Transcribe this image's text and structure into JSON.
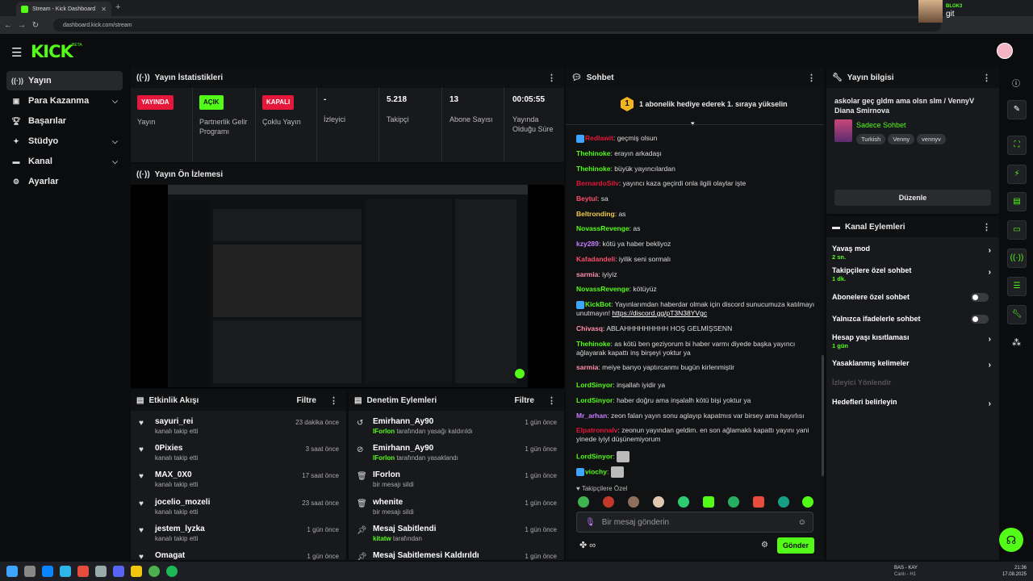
{
  "browser": {
    "tab_title": "Stream - Kick Dashboard",
    "url": "dashboard.kick.com/stream",
    "webcam_channel": "BLOK3",
    "webcam_user": "git"
  },
  "app": {
    "logo": "KICK",
    "logo_badge": "BETA"
  },
  "sidebar": {
    "items": [
      {
        "label": "Yayın"
      },
      {
        "label": "Para Kazanma"
      },
      {
        "label": "Başarılar"
      },
      {
        "label": "Stüdyo"
      },
      {
        "label": "Kanal"
      },
      {
        "label": "Ayarlar"
      }
    ]
  },
  "stats": {
    "title": "Yayın İstatistikleri",
    "items": [
      {
        "value": "YAYINDA",
        "label": "Yayın"
      },
      {
        "value": "AÇIK",
        "label": "Partnerlik Gelir Programı"
      },
      {
        "value": "KAPALI",
        "label": "Çoklu Yayın"
      },
      {
        "value": "-",
        "label": "İzleyici"
      },
      {
        "value": "5.218",
        "label": "Takipçi"
      },
      {
        "value": "13",
        "label": "Abone Sayısı"
      },
      {
        "value": "00:05:55",
        "label": "Yayında Olduğu Süre"
      }
    ]
  },
  "preview": {
    "title": "Yayın Ön İzlemesi"
  },
  "activity": {
    "title": "Etkinlik Akışı",
    "filter": "Filtre",
    "items": [
      {
        "user": "sayuri_rei",
        "action": "kanalı takip etti",
        "time": "23 dakika önce"
      },
      {
        "user": "0Pixies",
        "action": "kanalı takip etti",
        "time": "3 saat önce"
      },
      {
        "user": "MAX_0X0",
        "action": "kanalı takip etti",
        "time": "17 saat önce"
      },
      {
        "user": "jocelio_mozeli",
        "action": "kanalı takip etti",
        "time": "23 saat önce"
      },
      {
        "user": "jestem_lyzka",
        "action": "kanalı takip etti",
        "time": "1 gün önce"
      },
      {
        "user": "Omagat",
        "action": "",
        "time": "1 gün önce"
      }
    ]
  },
  "moderation": {
    "title": "Denetim Eylemleri",
    "filter": "Filtre",
    "items": [
      {
        "user": "Emirhann_Ay90",
        "by": "IForlon",
        "action": " tarafından yasağı kaldırıldı",
        "time": "1 gün önce"
      },
      {
        "user": "Emirhann_Ay90",
        "by": "IForlon",
        "action": " tarafından yasaklandı",
        "time": "1 gün önce"
      },
      {
        "user": "IForlon",
        "by": "",
        "action": "bir mesajı sildi",
        "time": "1 gün önce"
      },
      {
        "user": "whenite",
        "by": "",
        "action": "bir mesajı sildi",
        "time": "1 gün önce"
      },
      {
        "user": "Mesaj Sabitlendi",
        "by": "kitatw",
        "action": " tarafından",
        "time": "1 gün önce"
      },
      {
        "user": "Mesaj Sabitlemesi Kaldırıldı",
        "by": "",
        "action": "",
        "time": "1 gün önce"
      }
    ]
  },
  "chat": {
    "title": "Sohbet",
    "gift_rank": "1",
    "gift_text": "1 abonelik hediye ederek 1. sıraya yükselin",
    "messages": [
      {
        "user": "Redlawit",
        "color": "#e5173b",
        "text": "geçmiş olsun"
      },
      {
        "user": "Thehinoke",
        "color": "#53fc18",
        "text": "erayın arkadaşı"
      },
      {
        "user": "Thehinoke",
        "color": "#53fc18",
        "text": "büyük yayıncılardan"
      },
      {
        "user": "BernardoSilv",
        "color": "#e5173b",
        "text": "yayıncı kaza geçirdi onla ilgili olaylar işte"
      },
      {
        "user": "Beytul",
        "color": "#ff4d6d",
        "text": "sa"
      },
      {
        "user": "Beltronding",
        "color": "#f2c94c",
        "text": "as"
      },
      {
        "user": "NovassRevenge",
        "color": "#53fc18",
        "text": "as"
      },
      {
        "user": "kzy289",
        "color": "#c77dff",
        "text": "kötü ya haber bekliyoz"
      },
      {
        "user": "Kafadandeli",
        "color": "#ff4d6d",
        "text": "iyilik seni sormalı"
      },
      {
        "user": "sarmia",
        "color": "#ff8fab",
        "text": "iyiyiz"
      },
      {
        "user": "NovassRevenge",
        "color": "#53fc18",
        "text": "kötüyüz"
      },
      {
        "user": "KickBot",
        "color": "#53fc18",
        "text": "Yayınlarımdan haberdar olmak için discord sunucumuza katılmayı unutmayın! ",
        "link": "https://discord.gg/pT3N38YVgc"
      },
      {
        "user": "Chivasq",
        "color": "#ff8fab",
        "text": "ABLAHHHHHHHHH HOŞ GELMİŞSENN"
      },
      {
        "user": "Thehinoke",
        "color": "#53fc18",
        "text": "as kötü ben geziyorum bi haber varmı diyede başka yayıncı ağlayarak kapattı inş birşeyi yoktur ya"
      },
      {
        "user": "sarmia",
        "color": "#ff8fab",
        "text": "meiye banyo yaptırcanmı bugün kirlenmiştir"
      },
      {
        "user": "LordSinyor",
        "color": "#53fc18",
        "text": "inşallah iyidir ya"
      },
      {
        "user": "LordSinyor",
        "color": "#53fc18",
        "text": "haber doğru ama inşalalh kötü bişi yoktur ya"
      },
      {
        "user": "Mr_arhan",
        "color": "#c77dff",
        "text": "zeon falan yayın sonu aglayıp kapatmıs var birsey ama hayırlısı"
      },
      {
        "user": "Elpatronnalv",
        "color": "#e5173b",
        "text": "zeonun yayından geldim. en son ağlamaklı kapattı yayını yani yinede iyiyl düşünemiyorum"
      },
      {
        "user": "LordSinyor",
        "color": "#53fc18",
        "text": ""
      },
      {
        "user": "viochy",
        "color": "#53fc18",
        "text": ""
      }
    ],
    "emote_section": "Takipçilere Özel",
    "input_placeholder": "Bir mesaj gönderin",
    "send": "Gönder"
  },
  "stream_info": {
    "title": "Yayın bilgisi",
    "stream_title": "askolar geç gldm ama olsn slm / VennyV Diana Smirnova",
    "category": "Sadece Sohbet",
    "tags": [
      "Turkish",
      "Venny",
      "vennyv"
    ],
    "edit": "Düzenle"
  },
  "channel_actions": {
    "title": "Kanal Eylemleri",
    "items": [
      {
        "label": "Yavaş mod",
        "sub": "2 sn.",
        "kind": "chev"
      },
      {
        "label": "Takipçilere özel sohbet",
        "sub": "1 dk.",
        "kind": "chev"
      },
      {
        "label": "Abonelere özel sohbet",
        "sub": "",
        "kind": "toggle"
      },
      {
        "label": "Yalnızca ifadelerle sohbet",
        "sub": "",
        "kind": "toggle"
      },
      {
        "label": "Hesap yaşı kısıtlaması",
        "sub": "1 gün",
        "kind": "chev"
      },
      {
        "label": "Yasaklanmış kelimeler",
        "sub": "",
        "kind": "chev"
      },
      {
        "label": "İzleyici Yönlendir",
        "sub": "",
        "kind": "disabled"
      },
      {
        "label": "Hedefleri belirleyin",
        "sub": "",
        "kind": "chev"
      }
    ]
  },
  "taskbar": {
    "media_title": "BAS - KAY",
    "media_sub": "Canlı - H1",
    "time": "21:36",
    "date": "17.08.2025"
  },
  "colors": {
    "accent": "#53fc18",
    "live": "#e5173b",
    "panel": "#18191c"
  }
}
